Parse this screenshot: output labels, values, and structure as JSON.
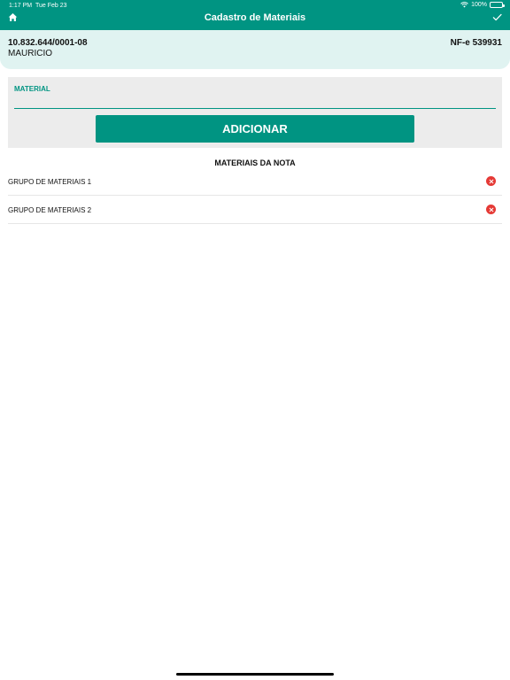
{
  "status_bar": {
    "time": "1:17 PM",
    "date": "Tue Feb 23",
    "battery": "100%"
  },
  "nav": {
    "title": "Cadastro de Materiais",
    "left_icon": "home-icon",
    "right_icon": "check-icon"
  },
  "info": {
    "cnpj": "10.832.644/0001-08",
    "name": "MAURICIO",
    "nfe": "NF-e 539931"
  },
  "form": {
    "material_label": "MATERIAL",
    "material_value": "",
    "add_label": "ADICIONAR"
  },
  "list": {
    "title": "MATERIAIS DA NOTA",
    "items": [
      {
        "label": "GRUPO DE MATERIAIS 1"
      },
      {
        "label": "GRUPO DE MATERIAIS 2"
      }
    ]
  },
  "colors": {
    "primary": "#009482",
    "info_bg": "#e0f3f1",
    "danger": "#e53935"
  }
}
